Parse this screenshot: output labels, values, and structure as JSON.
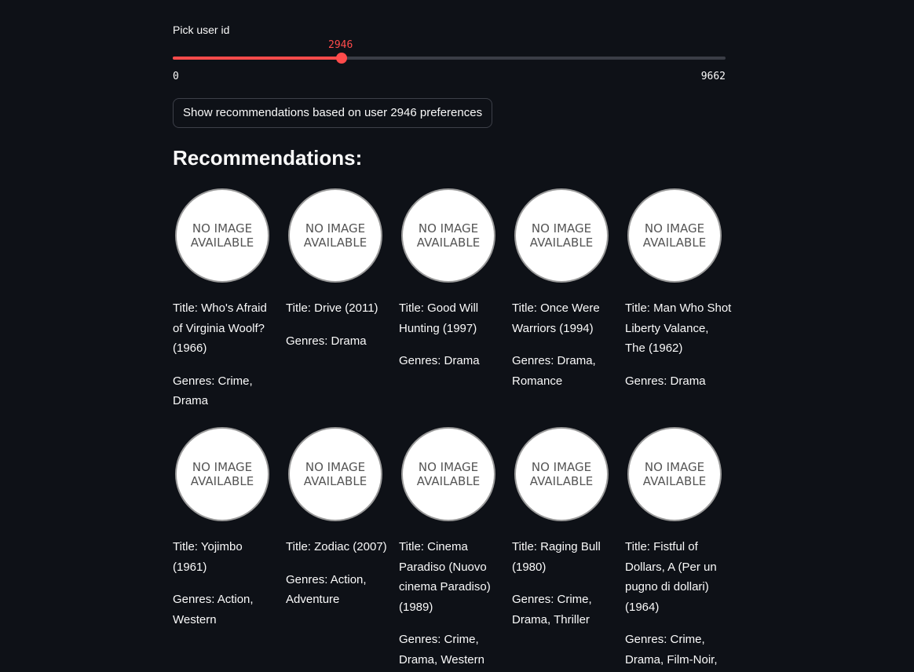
{
  "slider": {
    "label": "Pick user id",
    "value": "2946",
    "min": "0",
    "max": "9662",
    "fraction": 0.3049
  },
  "button": {
    "label": "Show recommendations based on user 2946 preferences"
  },
  "recommendations": {
    "heading": "Recommendations:",
    "placeholder_text": "NO IMAGE AVAILABLE",
    "items": [
      {
        "title": "Title: Who's Afraid of Virginia Woolf? (1966)",
        "genres": "Genres: Crime, Drama"
      },
      {
        "title": "Title: Drive (2011)",
        "genres": "Genres: Drama"
      },
      {
        "title": "Title: Good Will Hunting (1997)",
        "genres": "Genres: Drama"
      },
      {
        "title": "Title: Once Were Warriors (1994)",
        "genres": "Genres: Drama, Romance"
      },
      {
        "title": "Title: Man Who Shot Liberty Valance, The (1962)",
        "genres": "Genres: Drama"
      },
      {
        "title": "Title: Yojimbo (1961)",
        "genres": "Genres: Action, Western"
      },
      {
        "title": "Title: Zodiac (2007)",
        "genres": "Genres: Action, Adventure"
      },
      {
        "title": "Title: Cinema Paradiso (Nuovo cinema Paradiso) (1989)",
        "genres": "Genres: Crime, Drama, Western"
      },
      {
        "title": "Title: Raging Bull (1980)",
        "genres": "Genres: Crime, Drama, Thriller"
      },
      {
        "title": "Title: Fistful of Dollars, A (Per un pugno di dollari) (1964)",
        "genres": "Genres: Crime, Drama, Film-Noir,"
      }
    ]
  },
  "colors": {
    "background": "#0e1117",
    "accent": "#ff4b4b",
    "text": "#fafafa",
    "track": "#3a3d46"
  }
}
